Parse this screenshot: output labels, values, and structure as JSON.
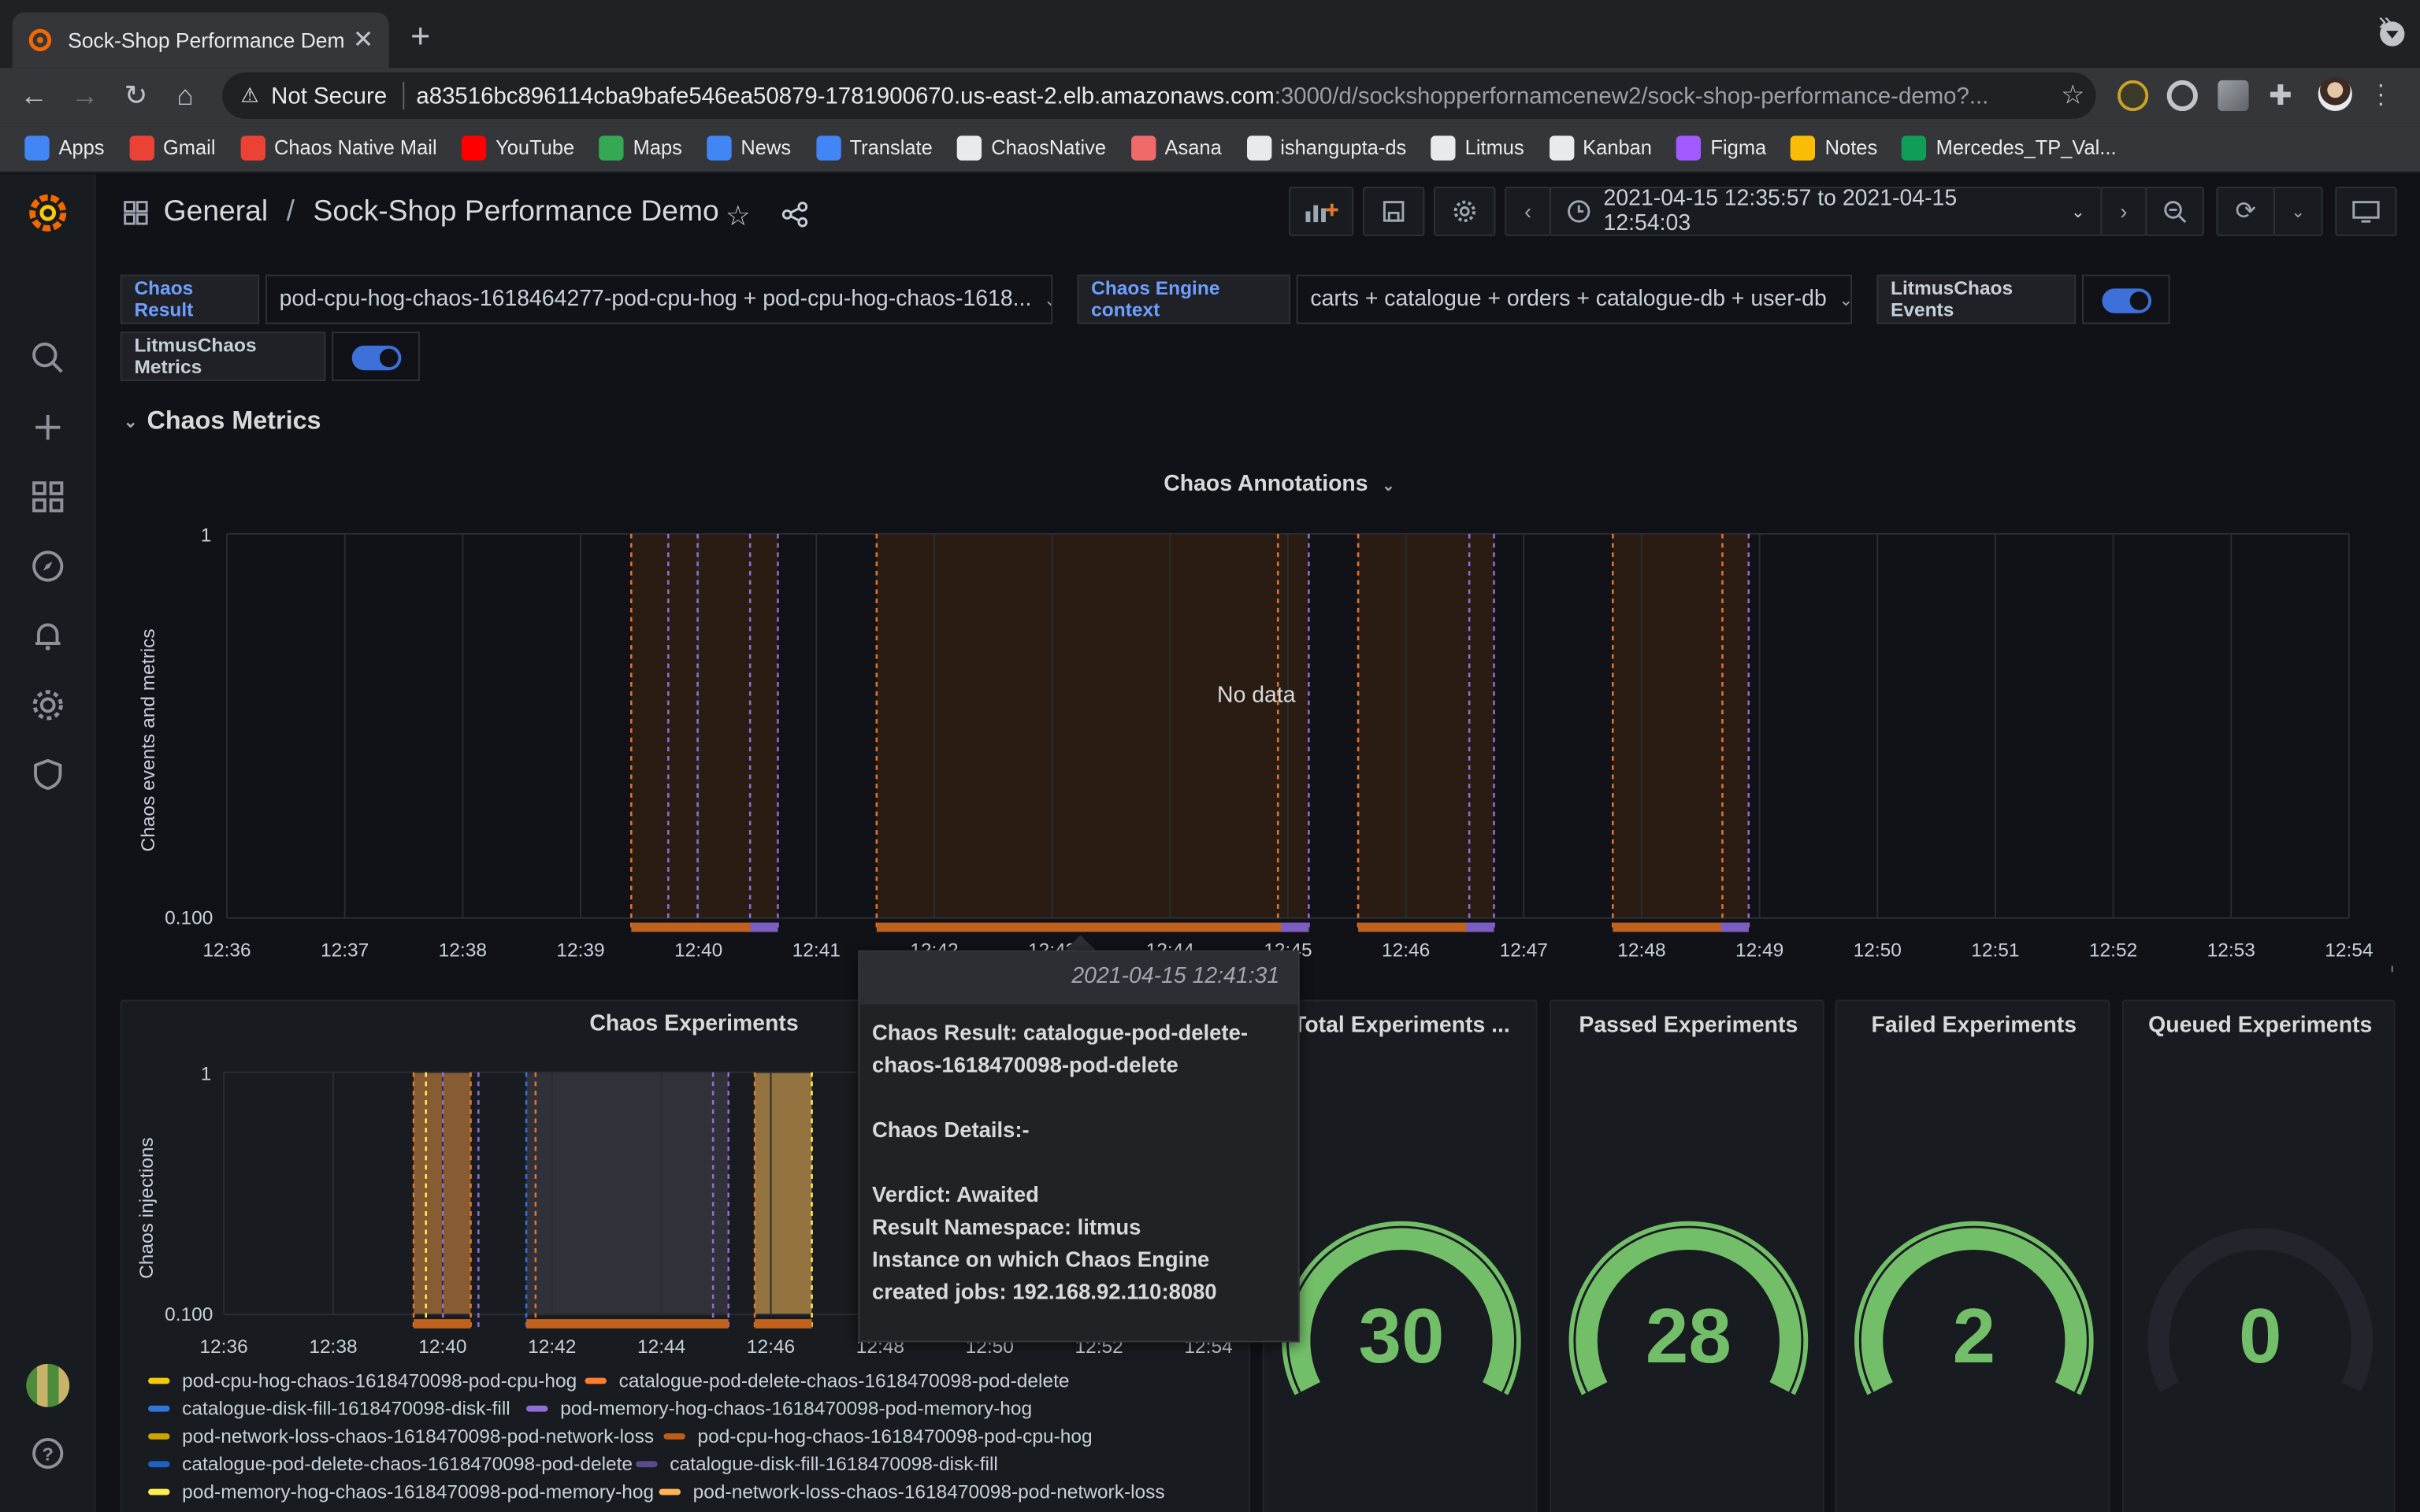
{
  "browser": {
    "tab_title": "Sock-Shop Performance Demo",
    "security": "Not Secure",
    "url_host": "a83516bc896114cba9bafe546ea50879-1781900670.us-east-2.elb.amazonaws.com",
    "url_path": ":3000/d/sockshopperfornamcenew2/sock-shop-performance-demo?...",
    "bookmarks": [
      {
        "label": "Apps",
        "color": "#4285f4"
      },
      {
        "label": "Gmail",
        "color": "#ea4335"
      },
      {
        "label": "Chaos Native Mail",
        "color": "#ea4335"
      },
      {
        "label": "YouTube",
        "color": "#ff0000"
      },
      {
        "label": "Maps",
        "color": "#34a853"
      },
      {
        "label": "News",
        "color": "#4285f4"
      },
      {
        "label": "Translate",
        "color": "#4285f4"
      },
      {
        "label": "ChaosNative",
        "color": "#e8eaed"
      },
      {
        "label": "Asana",
        "color": "#f06a6a"
      },
      {
        "label": "ishangupta-ds",
        "color": "#e8eaed"
      },
      {
        "label": "Litmus",
        "color": "#e8eaed"
      },
      {
        "label": "Kanban",
        "color": "#e8eaed"
      },
      {
        "label": "Figma",
        "color": "#a259ff"
      },
      {
        "label": "Notes",
        "color": "#fbbc04"
      },
      {
        "label": "Mercedes_TP_Val...",
        "color": "#0f9d58"
      }
    ]
  },
  "dashboard": {
    "folder": "General",
    "title": "Sock-Shop Performance Demo",
    "time_range": "2021-04-15 12:35:57 to 2021-04-15 12:54:03"
  },
  "variables": {
    "chaos_result_label": "Chaos Result",
    "chaos_result_value": "pod-cpu-hog-chaos-1618464277-pod-cpu-hog + pod-cpu-hog-chaos-1618...",
    "engine_context_label": "Chaos Engine context",
    "engine_context_value": "carts + catalogue + orders + catalogue-db + user-db",
    "events_label": "LitmusChaos Events",
    "metrics_label": "LitmusChaos Metrics"
  },
  "row": {
    "title": "Chaos Metrics"
  },
  "annotations_panel": {
    "title": "Chaos Annotations",
    "ylabel": "Chaos events and metrics",
    "no_data": "No data",
    "y_ticks": [
      "1",
      "0.100"
    ],
    "x_ticks": [
      "12:36",
      "12:37",
      "12:38",
      "12:39",
      "12:40",
      "12:41",
      "12:42",
      "12:43",
      "12:44",
      "12:45",
      "12:46",
      "12:47",
      "12:48",
      "12:49",
      "12:50",
      "12:51",
      "12:52",
      "12:53",
      "12:54"
    ]
  },
  "experiments_panel": {
    "title": "Chaos Experiments",
    "ylabel": "Chaos injections",
    "y_ticks": [
      "1",
      "0.100"
    ],
    "x_ticks": [
      "12:36",
      "12:38",
      "12:40",
      "12:42",
      "12:44",
      "12:46",
      "12:48",
      "12:50",
      "12:52",
      "12:54"
    ],
    "legend": [
      {
        "label": "pod-cpu-hog-chaos-1618470098-pod-cpu-hog",
        "color": "#f2cc0c"
      },
      {
        "label": "catalogue-pod-delete-chaos-1618470098-pod-delete",
        "color": "#ff7e2e"
      },
      {
        "label": "catalogue-disk-fill-1618470098-disk-fill",
        "color": "#3274d9"
      },
      {
        "label": "pod-memory-hog-chaos-1618470098-pod-memory-hog",
        "color": "#8f6ed5"
      },
      {
        "label": "pod-network-loss-chaos-1618470098-pod-network-loss",
        "color": "#cca300"
      },
      {
        "label": "pod-cpu-hog-chaos-1618470098-pod-cpu-hog",
        "color": "#c15c17"
      },
      {
        "label": "catalogue-pod-delete-chaos-1618470098-pod-delete",
        "color": "#1f60c4"
      },
      {
        "label": "catalogue-disk-fill-1618470098-disk-fill",
        "color": "#5a4b8c"
      },
      {
        "label": "pod-memory-hog-chaos-1618470098-pod-memory-hog",
        "color": "#ffee52"
      },
      {
        "label": "pod-network-loss-chaos-1618470098-pod-network-loss",
        "color": "#ffb357"
      }
    ]
  },
  "tooltip": {
    "time": "2021-04-15 12:41:31",
    "result": "Chaos Result: catalogue-pod-delete-chaos-1618470098-pod-delete",
    "details": "Chaos Details:-",
    "verdict": "Verdict: Awaited",
    "namespace": "Result Namespace: litmus",
    "instance": "Instance on which Chaos Engine created jobs: 192.168.92.110:8080"
  },
  "stats": [
    {
      "title": "Total Experiments ...",
      "value": "30",
      "fraction": 1.0
    },
    {
      "title": "Passed Experiments",
      "value": "28",
      "fraction": 1.0
    },
    {
      "title": "Failed Experiments",
      "value": "2",
      "fraction": 1.0
    },
    {
      "title": "Queued Experiments",
      "value": "0",
      "fraction": 0.0
    }
  ],
  "colors": {
    "accent": "#3d71d9",
    "gauge_green": "#73bf69",
    "annotation_orange": "#e0752d",
    "annotation_purple": "#8f6ed5"
  }
}
